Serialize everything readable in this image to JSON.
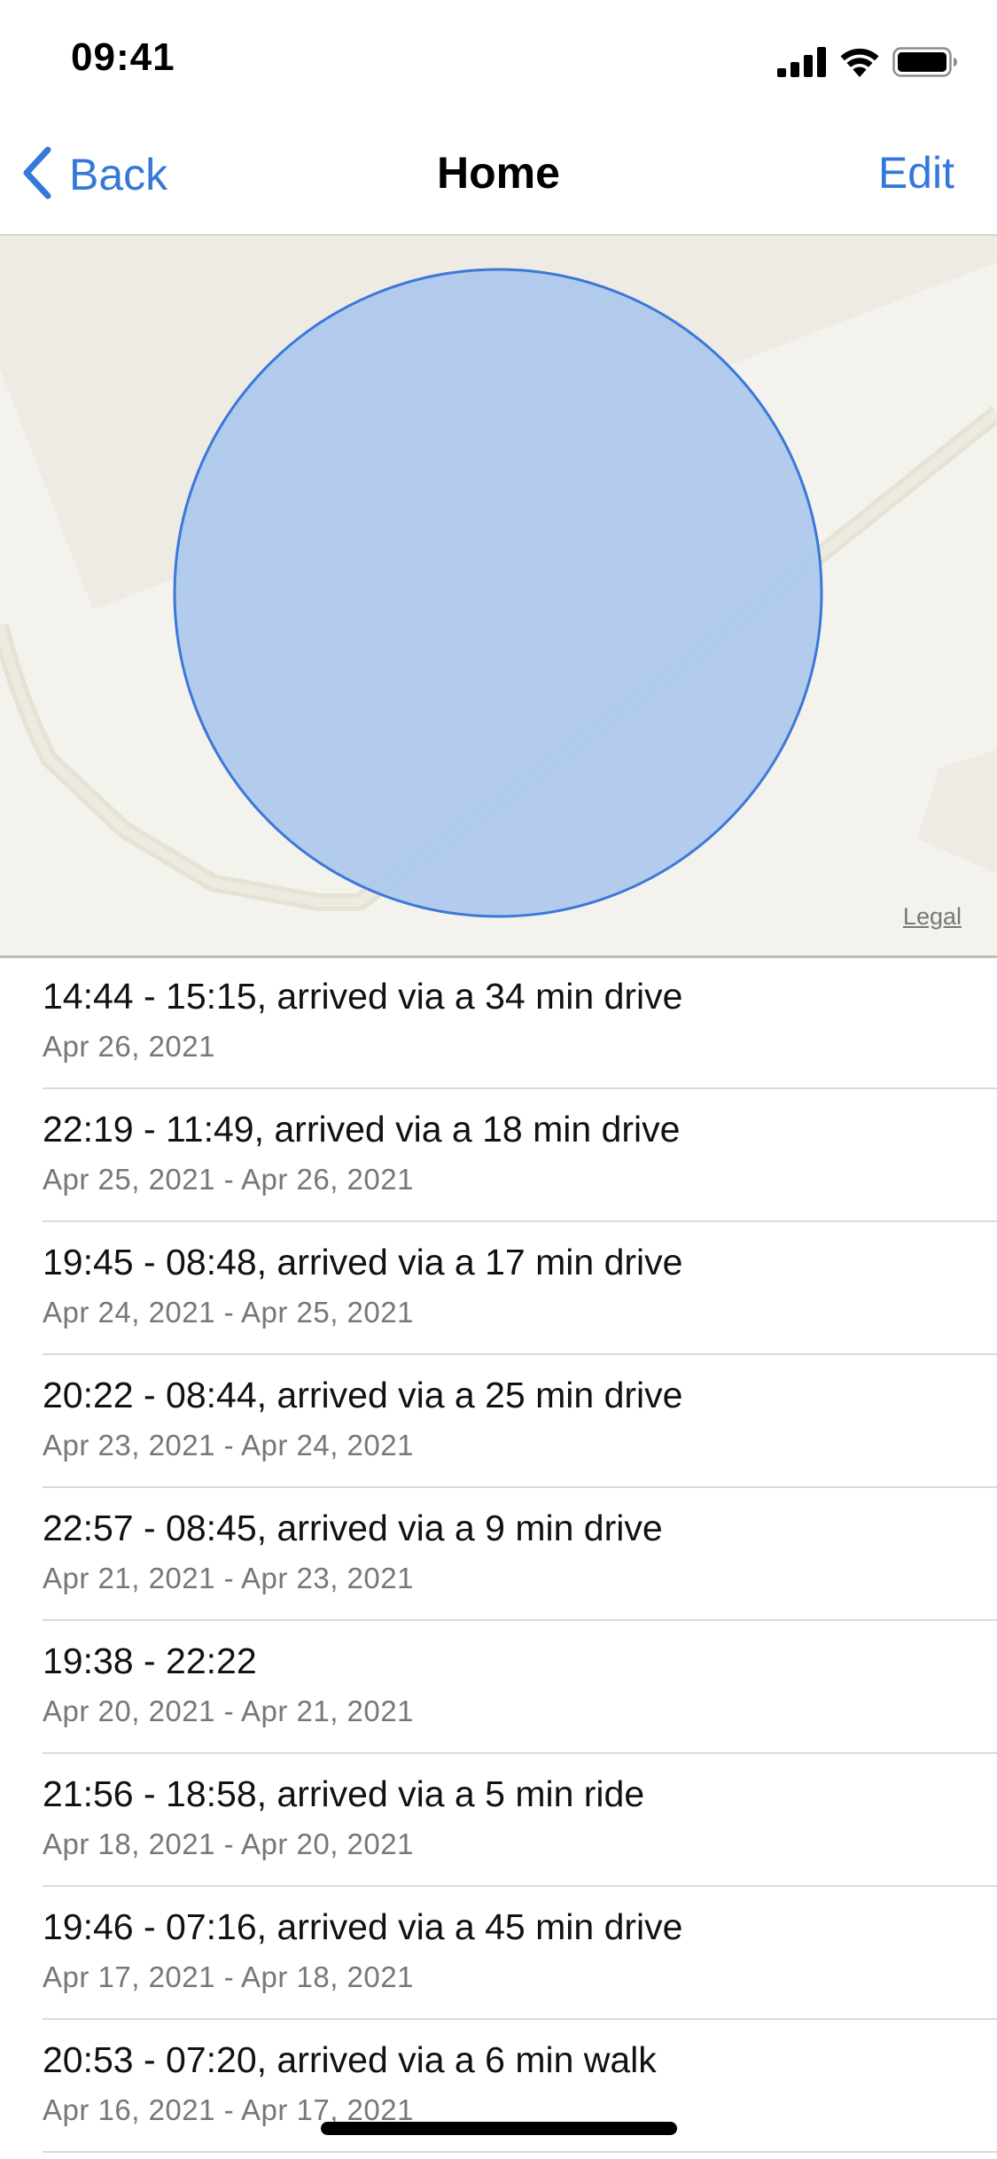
{
  "status_bar": {
    "time": "09:41",
    "icons": [
      "cellular-signal-icon",
      "wifi-icon",
      "battery-icon"
    ]
  },
  "nav": {
    "back_label": "Back",
    "title": "Home",
    "edit_label": "Edit",
    "accent_color": "#3478d9"
  },
  "map": {
    "legal_label": "Legal",
    "region_color": "#a7c6ef",
    "region_border_color": "#3c78d8"
  },
  "visits": [
    {
      "title": "14:44 - 15:15, arrived via a 34 min drive",
      "date": "Apr 26, 2021"
    },
    {
      "title": "22:19 - 11:49, arrived via a 18 min drive",
      "date": "Apr 25, 2021 - Apr 26, 2021"
    },
    {
      "title": "19:45 - 08:48, arrived via a 17 min drive",
      "date": "Apr 24, 2021 - Apr 25, 2021"
    },
    {
      "title": "20:22 - 08:44, arrived via a 25 min drive",
      "date": "Apr 23, 2021 - Apr 24, 2021"
    },
    {
      "title": "22:57 - 08:45, arrived via a 9 min drive",
      "date": "Apr 21, 2021 - Apr 23, 2021"
    },
    {
      "title": "19:38 - 22:22",
      "date": "Apr 20, 2021 - Apr 21, 2021"
    },
    {
      "title": "21:56 - 18:58, arrived via a 5 min ride",
      "date": "Apr 18, 2021 - Apr 20, 2021"
    },
    {
      "title": "19:46 - 07:16, arrived via a 45 min drive",
      "date": "Apr 17, 2021 - Apr 18, 2021"
    },
    {
      "title": "20:53 - 07:20, arrived via a 6 min walk",
      "date": "Apr 16, 2021 - Apr 17, 2021"
    }
  ]
}
